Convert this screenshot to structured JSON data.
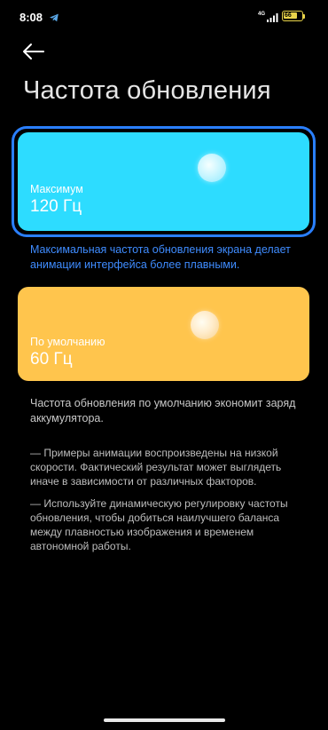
{
  "status_bar": {
    "time": "8:08",
    "network": "4G",
    "battery_level": "66",
    "battery_color": "#e9d44a",
    "icons": [
      "telegram-icon",
      "signal-icon",
      "battery-icon"
    ]
  },
  "header": {
    "back_icon": "arrow-left-icon",
    "title": "Частота обновления"
  },
  "options": {
    "max": {
      "label": "Максимум",
      "value": "120 Гц",
      "color": "#2ddcff",
      "selected": true,
      "description": "Максимальная частота обновления экрана делает анимации интерфейса более плавными."
    },
    "default": {
      "label": "По умолчанию",
      "value": "60 Гц",
      "color": "#ffc54d",
      "selected": false,
      "description": "Частота обновления по умолчанию экономит заряд аккумулятора."
    }
  },
  "notes": {
    "note1": "— Примеры анимации воспроизведены на низкой скорости. Фактический результат может выглядеть иначе в зависимости от различных факторов.",
    "note2": "— Используйте динамическую регулировку частоты обновления, чтобы добиться наилучшего баланса между плавностью изображения и временем автономной работы."
  },
  "colors": {
    "accent": "#3f8cff",
    "selection_ring": "#2a7fff",
    "background": "#000000"
  }
}
